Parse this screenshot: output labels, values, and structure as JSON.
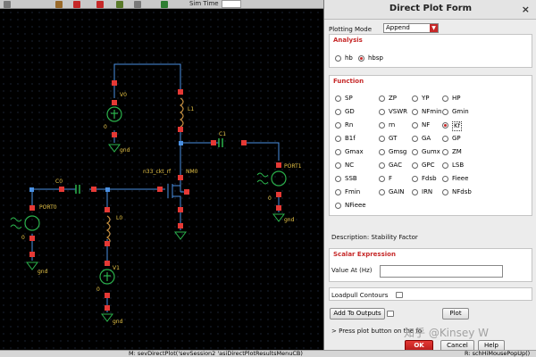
{
  "toolbar": {
    "sim_time_label": "Sim Time",
    "sim_time_value": ""
  },
  "schematic": {
    "labels": {
      "v0": "V0",
      "l1": "L1",
      "c1": "C1",
      "port1": "PORT1",
      "nmos": "n33_ckt_rf",
      "nm0": "NM0",
      "c0": "C0",
      "port0": "PORT0",
      "l0": "L0",
      "v1": "V1",
      "zero_a": "0",
      "zero_b": "0",
      "zero_c": "0",
      "zero_d": "0",
      "gnd_a": "gnd",
      "gnd_b": "gnd",
      "gnd_c": "gnd",
      "gnd_d": "gnd"
    }
  },
  "dialog": {
    "title": "Direct Plot Form",
    "close_glyph": "×",
    "plotting_mode_label": "Plotting Mode",
    "plotting_mode_value": "Append",
    "analysis": {
      "title": "Analysis",
      "options": [
        {
          "label": "hb",
          "selected": false
        },
        {
          "label": "hbsp",
          "selected": true
        }
      ]
    },
    "function": {
      "title": "Function",
      "options": [
        "SP",
        "ZP",
        "YP",
        "HP",
        "GD",
        "VSWR",
        "NFmin",
        "Gmin",
        "Rn",
        "rn",
        "NF",
        "Kf",
        "B1f",
        "GT",
        "GA",
        "GP",
        "Gmax",
        "Gmsg",
        "Gumx",
        "ZM",
        "NC",
        "GAC",
        "GPC",
        "LSB",
        "SSB",
        "F",
        "Fdsb",
        "Fieee",
        "Fmin",
        "GAIN",
        "IRN",
        "NFdsb",
        "NFieee"
      ],
      "selected": "Kf"
    },
    "description": "Description: Stability Factor",
    "scalar": {
      "title": "Scalar Expression",
      "value_label": "Value At (Hz)",
      "value": ""
    },
    "loadpull_label": "Loadpull Contours",
    "add_to_outputs": "Add To Outputs",
    "plot": "Plot",
    "prompt": "> Press plot button on the fo",
    "ok": "OK",
    "cancel": "Cancel",
    "help": "Help"
  },
  "statusbar": {
    "left": "M: sevDirectPlot('sevSession2 'asiDirectPlotResultsMenuCB)",
    "right": "R: schHiMousePopUp()"
  },
  "watermark": "知乎 @Kinsey W"
}
